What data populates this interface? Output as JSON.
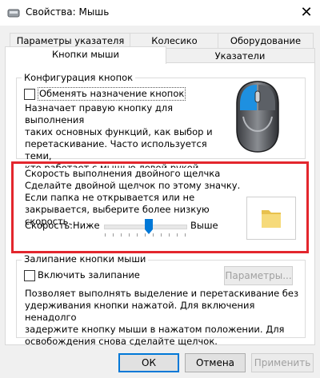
{
  "window": {
    "title": "Свойства: Мышь",
    "close_glyph": "✕"
  },
  "tabs": {
    "row1": [
      "Параметры указателя",
      "Колесико",
      "Оборудование"
    ],
    "row2": [
      "Кнопки мыши",
      "Указатели"
    ],
    "active": "Кнопки мыши"
  },
  "buttons_config": {
    "group_label": "Конфигурация кнопок",
    "swap_checkbox_label": "Обменять назначение кнопок",
    "swap_checked": false,
    "description": [
      "Назначает правую кнопку для выполнения",
      "таких основных функций, как выбор и",
      "перетаскивание. Часто используется теми,",
      "кто работает с мышью левой рукой."
    ]
  },
  "double_click": {
    "group_label": "Скорость выполнения двойного щелчка",
    "description": [
      "Сделайте двойной щелчок по этому значку.",
      "Если папка не открывается или не",
      "закрывается, выберите более низкую скорость."
    ],
    "speed_label": "Скорость:",
    "low_label": "Ниже",
    "high_label": "Выше",
    "slider_value": 0.55,
    "tick_count": 11,
    "folder_icon": "folder-icon"
  },
  "click_lock": {
    "group_label": "Залипание кнопки мыши",
    "checkbox_label": "Включить залипание",
    "checked": false,
    "settings_button": "Параметры...",
    "description": [
      "Позволяет выполнять выделение и перетаскивание без",
      "удерживания кнопки нажатой. Для включения ненадолго",
      "задержите кнопку мыши в нажатом положении. Для",
      "освобождения снова сделайте щелчок."
    ]
  },
  "footer": {
    "ok": "ОК",
    "cancel": "Отмена",
    "apply": "Применить"
  },
  "colors": {
    "highlight_box": "#e3262d",
    "mouse_button_blue": "#1e90e0",
    "folder_yellow": "#f2d36b"
  }
}
